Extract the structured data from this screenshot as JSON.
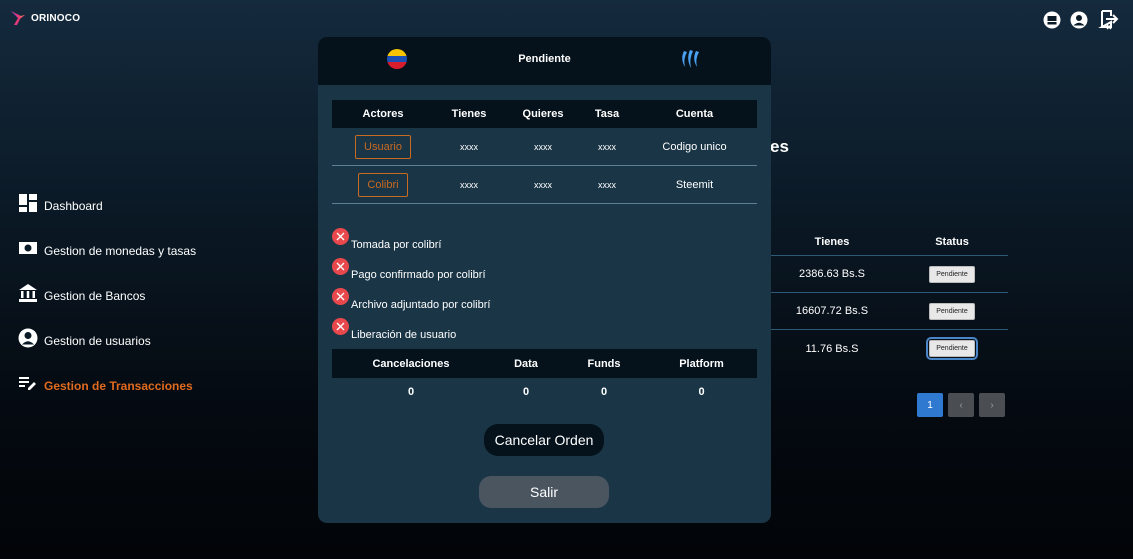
{
  "app": {
    "brand": "ORINOCO"
  },
  "topbar": {
    "icons": [
      "bank-card-icon",
      "user-circle-icon",
      "logout-icon"
    ]
  },
  "sidebar": {
    "items": [
      {
        "label": "Dashboard",
        "icon": "dashboard-icon",
        "active": false
      },
      {
        "label": "Gestion de monedas y tasas",
        "icon": "money-icon",
        "active": false
      },
      {
        "label": "Gestion de Bancos",
        "icon": "bank-icon",
        "active": false
      },
      {
        "label": "Gestion de usuarios",
        "icon": "user-icon",
        "active": false
      },
      {
        "label": "Gestion de Transacciones",
        "icon": "edit-list-icon",
        "active": true
      }
    ],
    "active_color": "#e06a1e"
  },
  "background": {
    "heading_fragment": "es",
    "table": {
      "headers": [
        "Tienes",
        "Status"
      ],
      "rows": [
        {
          "tienes": "2386.63 Bs.S",
          "status": "Pendiente"
        },
        {
          "tienes": "16607.72 Bs.S",
          "status": "Pendiente"
        },
        {
          "tienes": "11.76 Bs.S",
          "status": "Pendiente"
        }
      ]
    },
    "pagination": {
      "current": "1",
      "prev": "‹",
      "next": "›"
    }
  },
  "modal": {
    "title": "Pendiente",
    "actors_table": {
      "headers": [
        "Actores",
        "Tienes",
        "Quieres",
        "Tasa",
        "Cuenta"
      ],
      "rows": [
        {
          "actor": "Usuario",
          "tienes": "xxxx",
          "quieres": "xxxx",
          "tasa": "xxxx",
          "cuenta": "Codigo unico"
        },
        {
          "actor": "Colibri",
          "tienes": "xxxx",
          "quieres": "xxxx",
          "tasa": "xxxx",
          "cuenta": "Steemit"
        }
      ]
    },
    "steps": [
      {
        "label": "Tomada por colibrí",
        "done": false
      },
      {
        "label": "Pago confirmado por colibrí",
        "done": false
      },
      {
        "label": "Archivo adjuntado por colibrí",
        "done": false
      },
      {
        "label": "Liberación de usuario",
        "done": false
      }
    ],
    "cancel_table": {
      "headers": [
        "Cancelaciones",
        "Data",
        "Funds",
        "Platform"
      ],
      "values": [
        "0",
        "0",
        "0",
        "0"
      ]
    },
    "cancel_button": "Cancelar Orden",
    "exit_button": "Salir"
  },
  "colors": {
    "modal_bg": "#1a3546",
    "header_bg": "#05121c",
    "accent_orange": "#c96a22",
    "error_red": "#e8484c",
    "primary_blue": "#2f7ad0"
  }
}
